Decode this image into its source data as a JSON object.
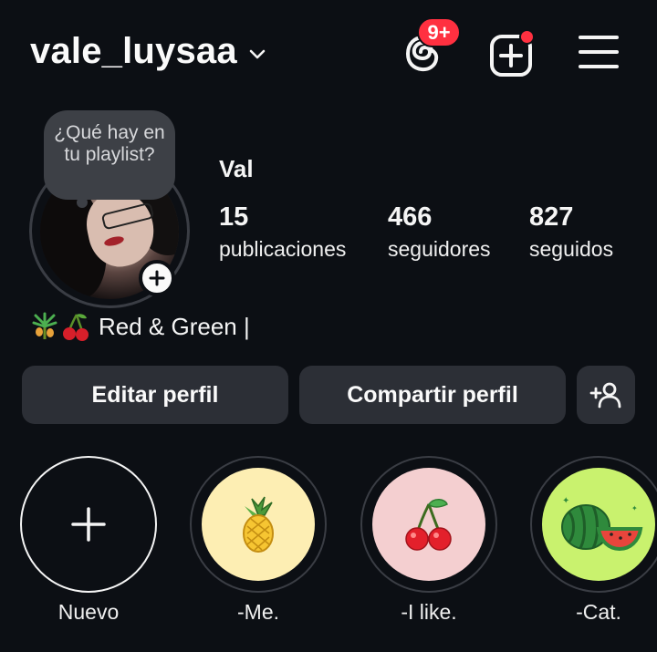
{
  "header": {
    "username": "vale_luysaa",
    "notification_badge": "9+",
    "badge_color": "#ff3040"
  },
  "profile": {
    "note_bubble": "¿Qué hay en tu playlist?",
    "display_name": "Val",
    "stats": [
      {
        "value": "15",
        "label": "publicaciones"
      },
      {
        "value": "466",
        "label": "seguidores"
      },
      {
        "value": "827",
        "label": "seguidos"
      }
    ],
    "bio": "Red & Green |",
    "bio_icons": [
      "pineapple-plant-emoji",
      "cherries-emoji"
    ]
  },
  "actions": {
    "edit_label": "Editar perfil",
    "share_label": "Compartir perfil"
  },
  "highlights": [
    {
      "label": "Nuevo",
      "icon": "plus-icon"
    },
    {
      "label": "-Me.",
      "icon": "pineapple-icon",
      "bg": "#fdeeb3"
    },
    {
      "label": "-I like.",
      "icon": "cherry-icon",
      "bg": "#f4cfd0"
    },
    {
      "label": "-Cat.",
      "icon": "watermelon-icon",
      "bg": "#c9f26e"
    }
  ],
  "colors": {
    "background": "#0c0f14",
    "button_bg": "#2c2f36",
    "accent_red": "#ff3040"
  }
}
